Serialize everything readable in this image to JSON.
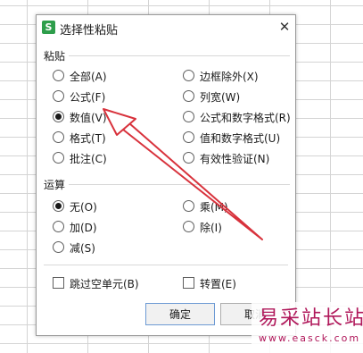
{
  "dialog": {
    "app_icon_glyph": "S",
    "title": "选择性粘贴",
    "close_glyph": "✕"
  },
  "paste_group": {
    "label": "粘贴",
    "options": [
      {
        "label": "全部(A)",
        "selected": false
      },
      {
        "label": "公式(F)",
        "selected": false
      },
      {
        "label": "数值(V)",
        "selected": true
      },
      {
        "label": "格式(T)",
        "selected": false
      },
      {
        "label": "批注(C)",
        "selected": false
      },
      {
        "label": "边框除外(X)",
        "selected": false
      },
      {
        "label": "列宽(W)",
        "selected": false
      },
      {
        "label": "公式和数字格式(R)",
        "selected": false
      },
      {
        "label": "值和数字格式(U)",
        "selected": false
      },
      {
        "label": "有效性验证(N)",
        "selected": false
      }
    ]
  },
  "operation_group": {
    "label": "运算",
    "options": [
      {
        "label": "无(O)",
        "selected": true
      },
      {
        "label": "加(D)",
        "selected": false
      },
      {
        "label": "减(S)",
        "selected": false
      },
      {
        "label": "乘(M)",
        "selected": false
      },
      {
        "label": "除(I)",
        "selected": false
      }
    ]
  },
  "checkboxes": {
    "skip_blanks": {
      "label": "跳过空单元(B)",
      "checked": false
    },
    "transpose": {
      "label": "转置(E)",
      "checked": false
    }
  },
  "buttons": {
    "ok": "确定",
    "cancel": "取消"
  },
  "watermark": {
    "text": "易采站长站",
    "url": "www.easck.com"
  },
  "colors": {
    "annotation_arrow": "#d8323c",
    "watermark": "#b0175a",
    "app_icon": "#2e9e4b"
  }
}
